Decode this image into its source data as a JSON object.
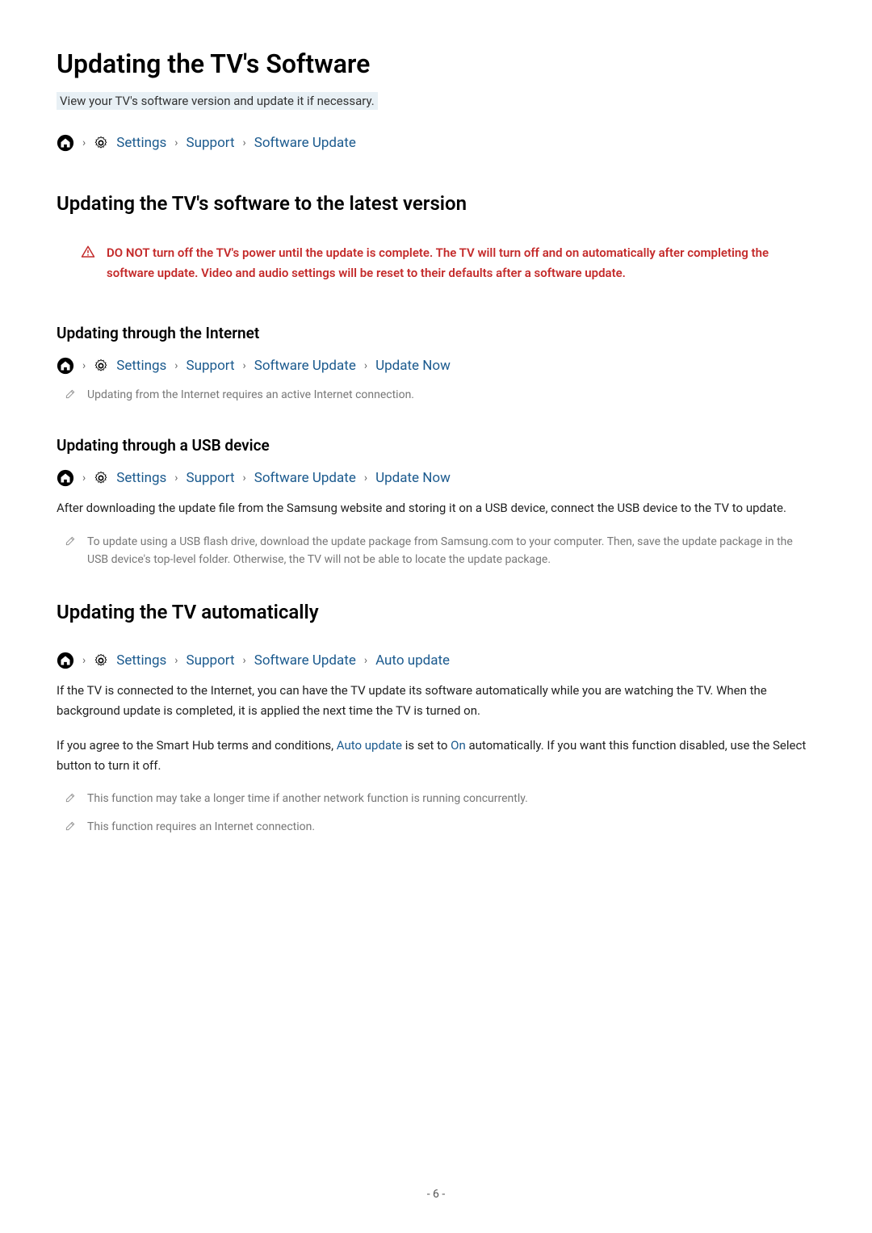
{
  "title": "Updating the TV's Software",
  "subtitle": "View your TV's software version and update it if necessary.",
  "breadcrumb1": {
    "settings": "Settings",
    "support": "Support",
    "software_update": "Software Update"
  },
  "section1": {
    "heading": "Updating the TV's software to the latest version",
    "warning": "DO NOT turn off the TV's power until the update is complete. The TV will turn off and on automatically after completing the software update. Video and audio settings will be reset to their defaults after a software update."
  },
  "section_internet": {
    "heading": "Updating through the Internet",
    "breadcrumb": {
      "settings": "Settings",
      "support": "Support",
      "software_update": "Software Update",
      "update_now": "Update Now"
    },
    "note": "Updating from the Internet requires an active Internet connection."
  },
  "section_usb": {
    "heading": "Updating through a USB device",
    "breadcrumb": {
      "settings": "Settings",
      "support": "Support",
      "software_update": "Software Update",
      "update_now": "Update Now"
    },
    "body": "After downloading the update file from the Samsung website and storing it on a USB device, connect the USB device to the TV to update.",
    "note": "To update using a USB flash drive, download the update package from Samsung.com to your computer. Then, save the update package in the USB device's top-level folder. Otherwise, the TV will not be able to locate the update package."
  },
  "section_auto": {
    "heading": "Updating the TV automatically",
    "breadcrumb": {
      "settings": "Settings",
      "support": "Support",
      "software_update": "Software Update",
      "auto_update": "Auto update"
    },
    "body1": "If the TV is connected to the Internet, you can have the TV update its software automatically while you are watching the TV. When the background update is completed, it is applied the next time the TV is turned on.",
    "body2_pre": "If you agree to the Smart Hub terms and conditions, ",
    "body2_link1": "Auto update",
    "body2_mid": " is set to ",
    "body2_link2": "On",
    "body2_post": " automatically. If you want this function disabled, use the Select button to turn it off.",
    "note1": "This function may take a longer time if another network function is running concurrently.",
    "note2": "This function requires an Internet connection."
  },
  "page_number": "- 6 -"
}
